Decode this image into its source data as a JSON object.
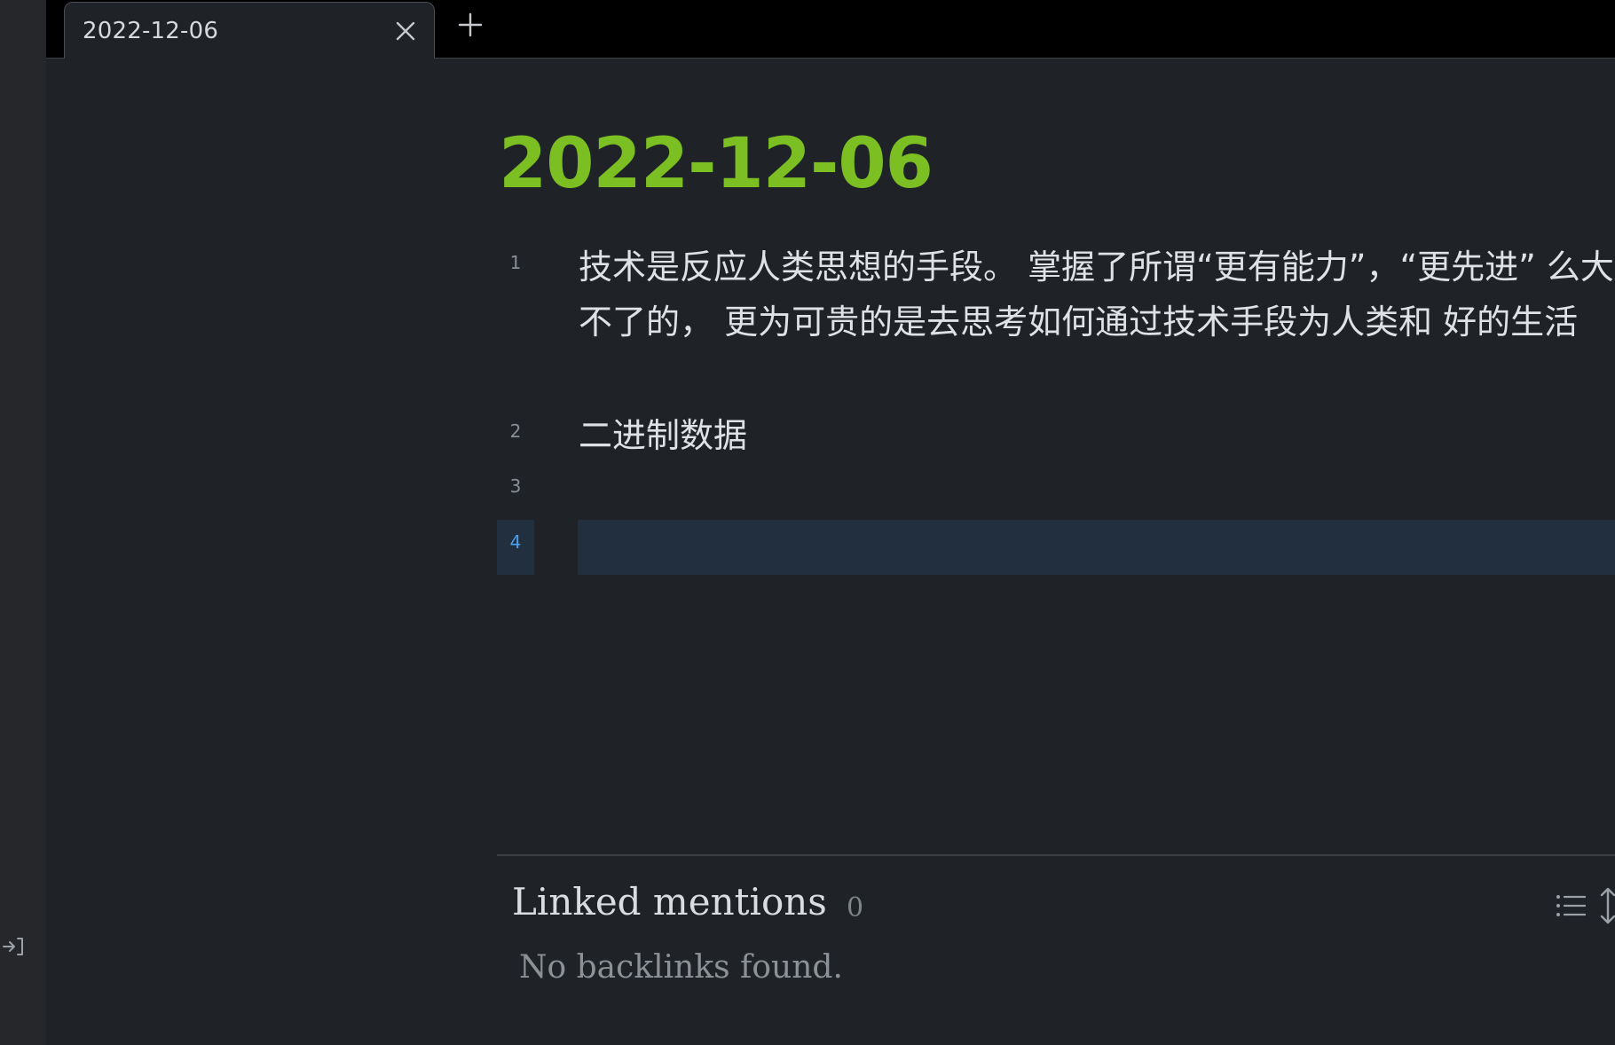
{
  "tabs": [
    {
      "label": "2022-12-06"
    }
  ],
  "note": {
    "title": "2022-12-06",
    "lines": [
      {
        "number": "1",
        "text": "技术是反应人类思想的手段。 掌握了所谓“更有能力”，“更先进” 么大不了的， 更为可贵的是去思考如何通过技术手段为人类和 好的生活"
      },
      {
        "number": "2",
        "text": "二进制数据"
      },
      {
        "number": "3",
        "text": ""
      },
      {
        "number": "4",
        "text": ""
      }
    ],
    "active_line": 4
  },
  "backlinks": {
    "title": "Linked mentions",
    "count": "0",
    "empty_message": "No backlinks found."
  },
  "colors": {
    "title": "#7bbf22",
    "active_line_number": "#4a9eea",
    "background": "#1f2328"
  },
  "icons": {
    "tab_close": "close-icon",
    "new_tab": "plus-icon",
    "list_view": "list-icon",
    "expand": "expand-vertical-icon",
    "sidebar_toggle": "sidebar-expand-icon"
  }
}
